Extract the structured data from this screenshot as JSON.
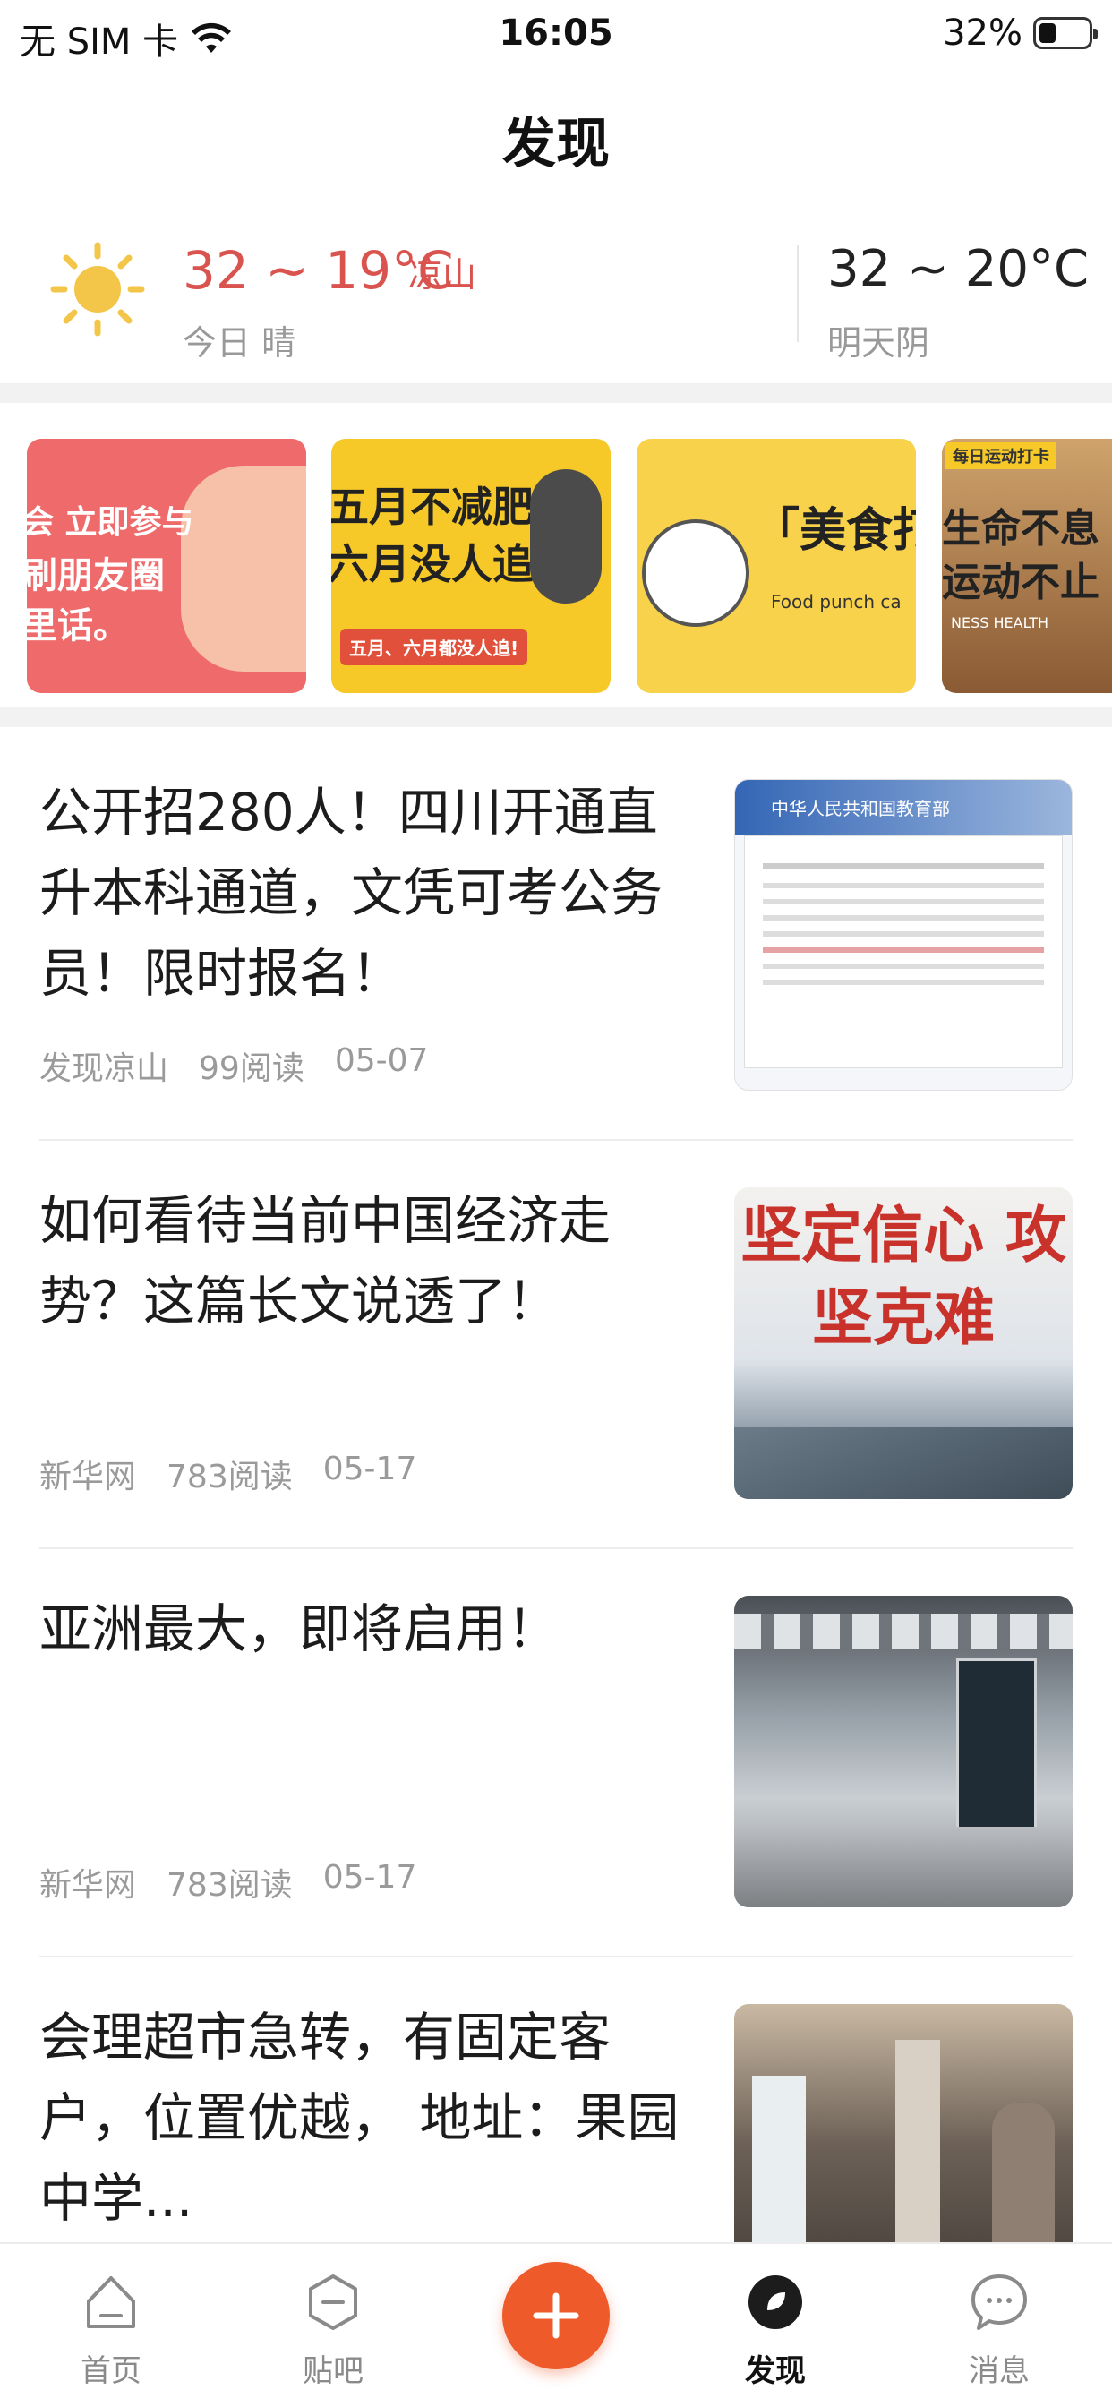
{
  "status_bar": {
    "carrier": "无 SIM 卡",
    "time": "16:05",
    "battery": "32%"
  },
  "nav": {
    "title": "发现"
  },
  "weather": {
    "today_temp": "32 ~ 19°C",
    "city": "凉山",
    "today_desc": "今日 晴",
    "tomorrow_temp": "32 ~ 20°C",
    "tomorrow_desc": "明天阴",
    "accent_color": "#d9534f"
  },
  "banners": [
    {
      "lines": [
        "会  立即参与",
        "刷朋友圈",
        "里话。"
      ],
      "bg": "#ef6a6a"
    },
    {
      "lines": [
        "五月不减肥",
        "六月没人追",
        "五月、六月都没人追!"
      ],
      "bg": "#f6c928"
    },
    {
      "lines": [
        "「美食打",
        "Food punch ca"
      ],
      "bg": "#f7d24a"
    },
    {
      "lines": [
        "每日运动打卡",
        "生命不息",
        "运动不止",
        "NESS HEALTH"
      ],
      "bg": "#caa36a"
    }
  ],
  "articles": [
    {
      "title": "公开招280人！四川开通直升本科通道，文凭可考公务员！限时报名！",
      "source": "发现凉山",
      "reads": "99阅读",
      "date": "05-07",
      "thumb_caption": "中华人民共和国教育部"
    },
    {
      "title": "如何看待当前中国经济走势？这篇长文说透了！",
      "source": "新华网",
      "reads": "783阅读",
      "date": "05-17",
      "thumb_caption": "坚定信心 攻坚克难"
    },
    {
      "title": "亚洲最大，即将启用！",
      "source": "新华网",
      "reads": "783阅读",
      "date": "05-17",
      "thumb_caption": ""
    },
    {
      "title": "会理超市急转，有固定客户，位置优越， 地址：果园中学...",
      "source": "",
      "reads": "",
      "date": "",
      "thumb_caption": ""
    }
  ],
  "tabbar": {
    "items": [
      {
        "label": "首页",
        "icon": "home-icon"
      },
      {
        "label": "贴吧",
        "icon": "forum-icon"
      },
      {
        "label": "",
        "icon": "plus-icon"
      },
      {
        "label": "发现",
        "icon": "discover-icon",
        "active": true
      },
      {
        "label": "消息",
        "icon": "message-icon"
      }
    ],
    "fab_color": "#ef5a2b"
  }
}
